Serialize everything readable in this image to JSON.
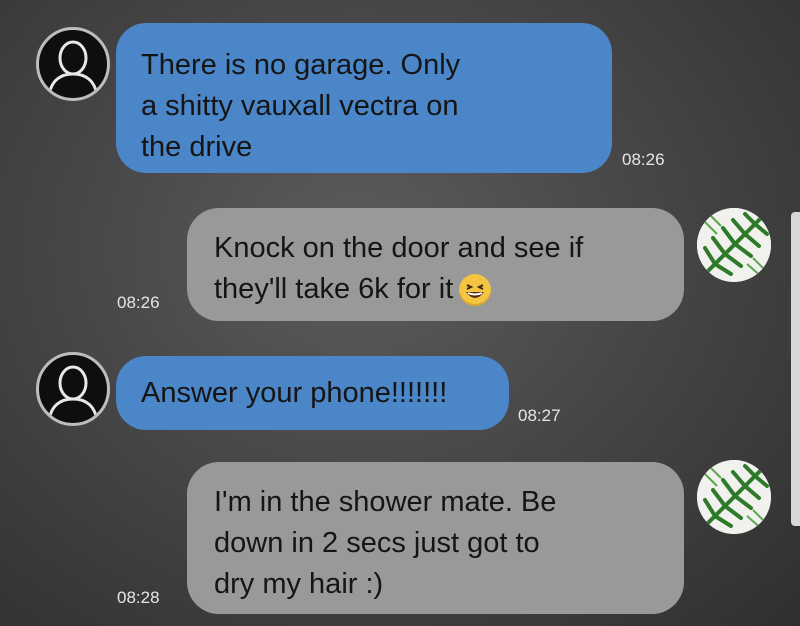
{
  "messages": [
    {
      "side": "left",
      "text": "There is no garage. Only\na shitty vauxall vectra on\nthe drive",
      "time": "08:26"
    },
    {
      "side": "right",
      "text": "Knock on the door and see if\nthey'll take 6k for it",
      "emoji": "laughing-emoji",
      "time": "08:26"
    },
    {
      "side": "left",
      "text": "Answer your phone!!!!!!!",
      "time": "08:27"
    },
    {
      "side": "right",
      "text": "I'm in the shower mate. Be\ndown in 2 secs just got to\ndry my hair  :)",
      "time": "08:28"
    }
  ],
  "colors": {
    "left_bubble": "#4a86c8",
    "right_bubble": "#999999",
    "background": "#474747",
    "time_text": "#e6e6e6"
  },
  "icons": {
    "left_avatar": "person-silhouette-icon",
    "right_avatar": "fern-leaf-avatar"
  }
}
